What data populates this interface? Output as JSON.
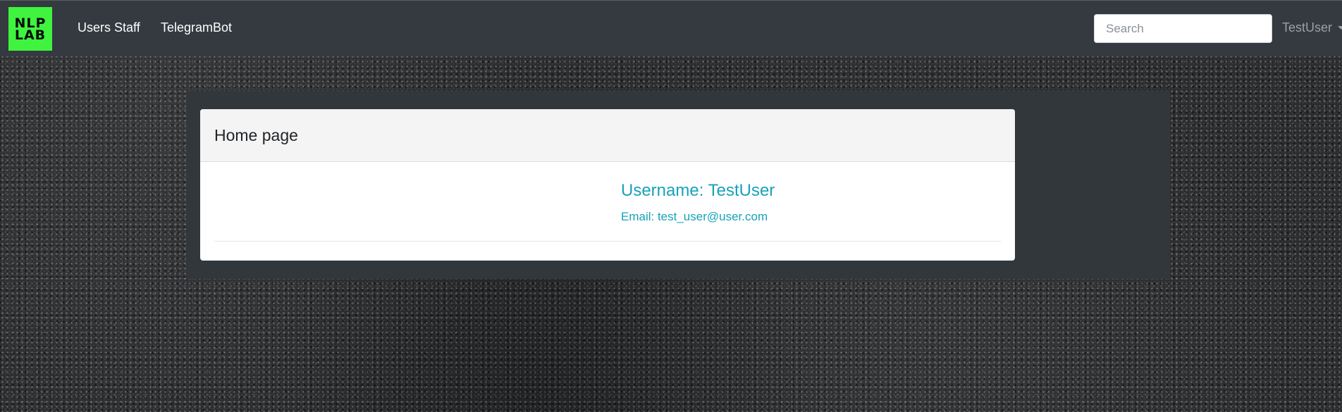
{
  "brand": {
    "logo_line1": "NLP",
    "logo_line2": "LAB",
    "logo_color": "#3ff33f"
  },
  "navbar": {
    "links": [
      {
        "label": "Users Staff"
      },
      {
        "label": "TelegramBot"
      }
    ],
    "search": {
      "placeholder": "Search",
      "value": ""
    },
    "user_menu": {
      "label": "TestUser",
      "icon": "caret-down-icon"
    }
  },
  "card": {
    "title": "Home page",
    "username_text": "Username: TestUser",
    "email_text": "Email: test_user@user.com"
  },
  "colors": {
    "navbar": "#343a40",
    "accent": "#17a2b8",
    "panel": "#32373c"
  }
}
